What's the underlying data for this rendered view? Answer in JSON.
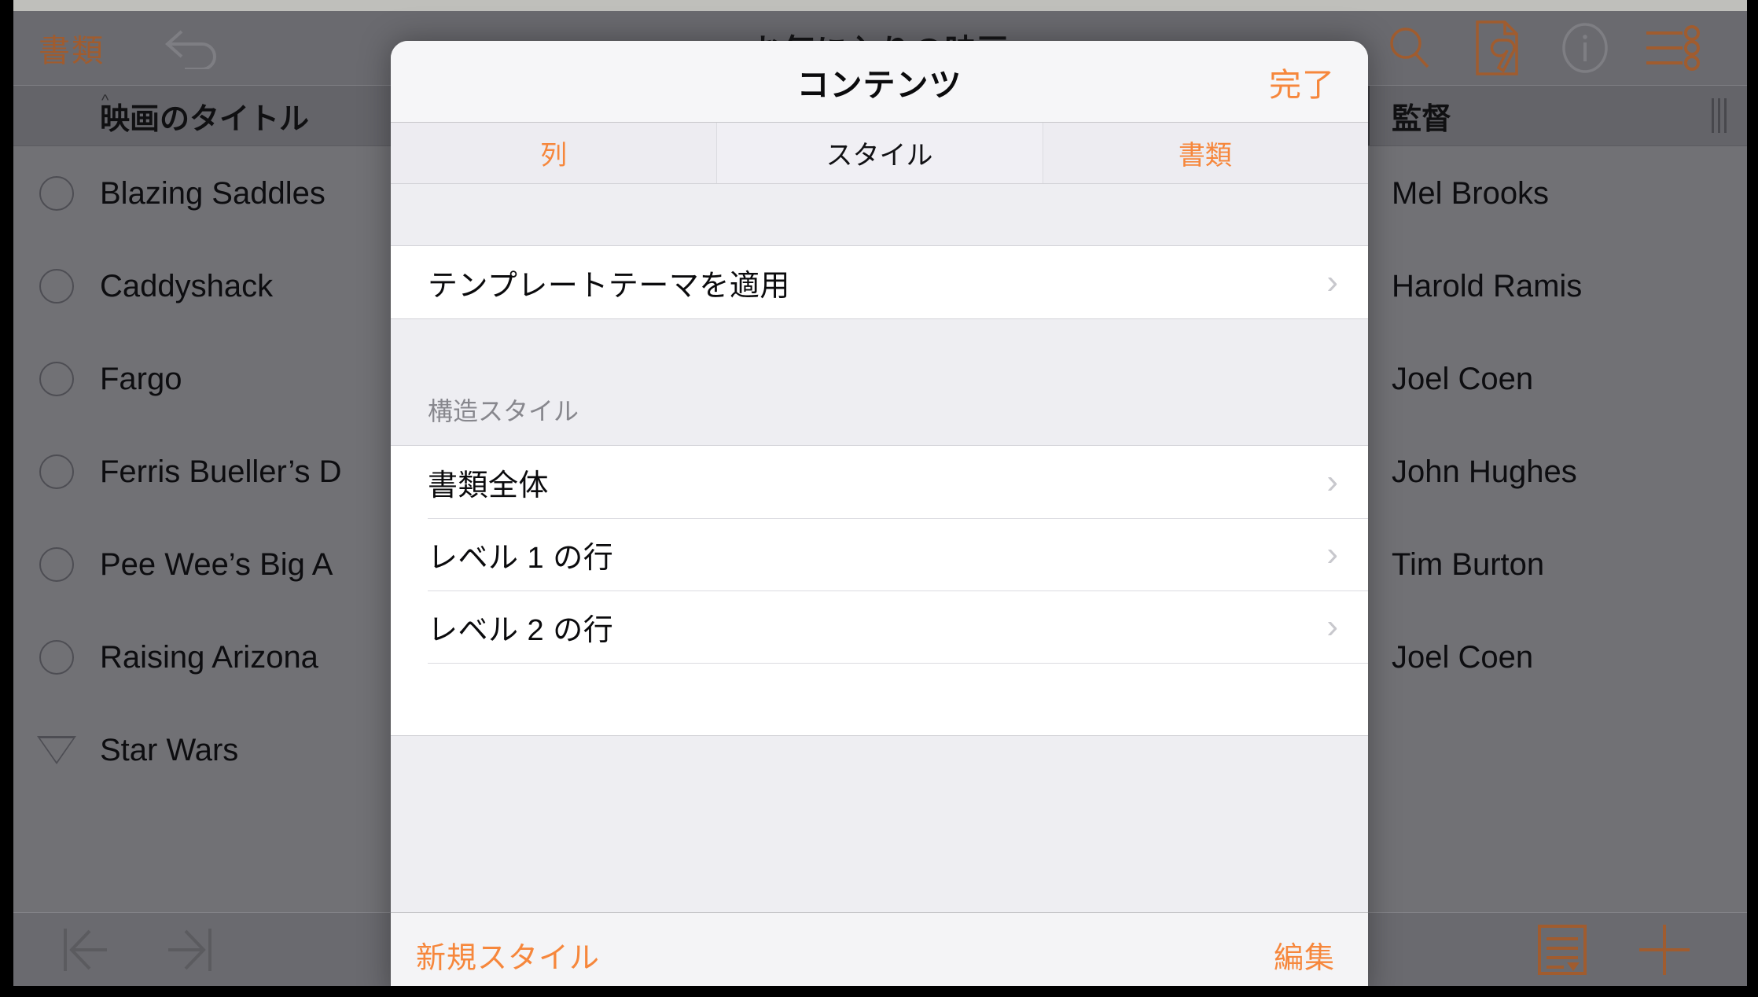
{
  "app": {
    "toolbar": {
      "documents_label": "書類",
      "document_title": "お気に入りの映画",
      "undo_icon": "undo-arrow-icon",
      "search_icon": "search-icon",
      "tools_icon": "document-tools-icon",
      "info_icon": "info-icon",
      "settings_icon": "settings-sliders-icon"
    },
    "table": {
      "columns": [
        "映画のタイトル",
        "監督"
      ],
      "sort_indicator": "ascending-caret",
      "rows": [
        {
          "bullet": "circle",
          "title": "Blazing Saddles",
          "director": "Mel Brooks"
        },
        {
          "bullet": "circle",
          "title": "Caddyshack",
          "director": "Harold Ramis"
        },
        {
          "bullet": "circle",
          "title": "Fargo",
          "director": "Joel Coen"
        },
        {
          "bullet": "circle",
          "title": "Ferris Bueller’s D",
          "director": "John Hughes"
        },
        {
          "bullet": "circle",
          "title": "Pee Wee’s Big A",
          "director": "Tim Burton"
        },
        {
          "bullet": "circle",
          "title": "Raising Arizona",
          "director": "Joel Coen"
        },
        {
          "bullet": "triangle",
          "title": "Star Wars",
          "director": ""
        }
      ]
    },
    "bottombar": {
      "first_record_icon": "jump-to-first-icon",
      "last_record_icon": "jump-to-last-icon",
      "form_view_icon": "form-view-icon",
      "add_icon": "plus-icon"
    }
  },
  "modal": {
    "title": "コンテンツ",
    "done_label": "完了",
    "tabs": [
      {
        "label": "列",
        "active": false
      },
      {
        "label": "スタイル",
        "active": true
      },
      {
        "label": "書類",
        "active": false
      }
    ],
    "apply_theme": {
      "label": "テンプレートテーマを適用",
      "chevron": "chevron-right-icon"
    },
    "section_label": "構造スタイル",
    "structure_styles": [
      {
        "label": "書類全体",
        "chevron": "chevron-right-icon"
      },
      {
        "label": "レベル 1 の行",
        "chevron": "chevron-right-icon"
      },
      {
        "label": "レベル 2 の行",
        "chevron": "chevron-right-icon"
      }
    ],
    "footer": {
      "new_style_label": "新規スタイル",
      "edit_label": "編集"
    }
  },
  "colors": {
    "accent_orange": "#f6873c",
    "toolbar_orange": "#c4713a",
    "app_gray": "#8a8a8f",
    "group_bg": "#eeeef2"
  }
}
